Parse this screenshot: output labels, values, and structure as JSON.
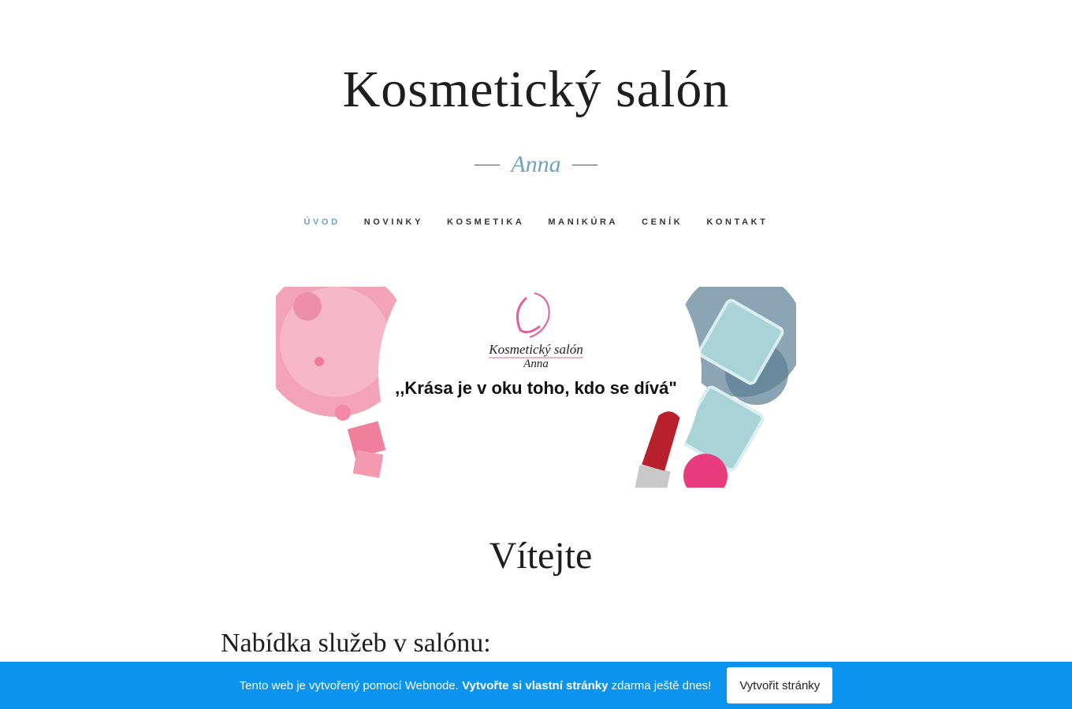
{
  "header": {
    "site_title": "Kosmetický salón",
    "subtitle": "Anna"
  },
  "nav": {
    "items": [
      {
        "label": "ÚVOD",
        "active": true
      },
      {
        "label": "NOVINKY",
        "active": false
      },
      {
        "label": "KOSMETIKA",
        "active": false
      },
      {
        "label": "MANIKÚRA",
        "active": false
      },
      {
        "label": "CENÍK",
        "active": false
      },
      {
        "label": "KONTAKT",
        "active": false
      }
    ]
  },
  "banner": {
    "logo_title": "Kosmetický salón",
    "logo_subtitle": "Anna",
    "quote": ",,Krása je v oku toho, kdo se dívá\""
  },
  "main": {
    "welcome_heading": "Vítejte",
    "services_heading": "Nabídka služeb v salónu:"
  },
  "promo_bar": {
    "text_prefix": "Tento web je vytvořený pomocí Webnode. ",
    "text_bold": "Vytvořte si vlastní stránky",
    "text_suffix": " zdarma ještě dnes!",
    "button_label": "Vytvořit stránky"
  },
  "colors": {
    "accent": "#6fa3c4",
    "promo_bar": "#0b93f0",
    "text": "#1e1e1e"
  }
}
